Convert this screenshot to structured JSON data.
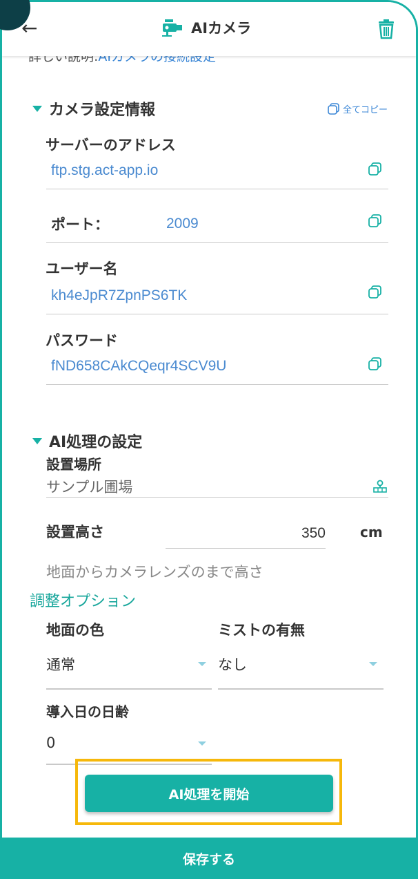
{
  "header": {
    "title": "AIカメラ"
  },
  "peek_text": {
    "prefix": "詳しい説明:",
    "link": "AIカメラの接続設定"
  },
  "camera_section": {
    "title": "カメラ設定情報",
    "copy_all_label": "全てコピー",
    "fields": [
      {
        "label": "サーバーのアドレス",
        "value": "ftp.stg.act-app.io"
      },
      {
        "label": "ポート：",
        "value": "2009"
      },
      {
        "label": "ユーザー名",
        "value": "kh4eJpR7ZpnPS6TK"
      },
      {
        "label": "パスワード",
        "value": "fND658CAkCQeqr4SCV9U"
      }
    ]
  },
  "ai_section": {
    "title": "AI処理の設定",
    "location_label": "設置場所",
    "location_value": "サンプル圃場",
    "height_label": "設置高さ",
    "height_value": "350",
    "height_unit": "cm",
    "height_hint": "地面からカメラレンズのまで高さ",
    "options_link": "調整オプション",
    "ground_color_label": "地面の色",
    "ground_color_value": "通常",
    "mist_label": "ミストの有無",
    "mist_value": "なし",
    "age_label": "導入日の日齢",
    "age_value": "0",
    "start_button": "AI処理を開始"
  },
  "footer": {
    "save_label": "保存する"
  },
  "colors": {
    "accent": "#17b1a5",
    "link": "#3a86d6",
    "highlight": "#f6b80b"
  }
}
